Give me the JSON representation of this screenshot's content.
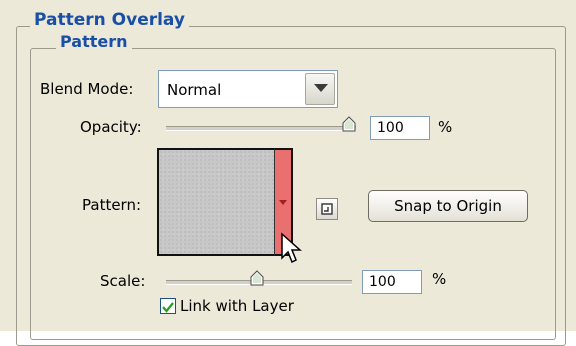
{
  "group": {
    "title": "Pattern Overlay",
    "subtitle": "Pattern"
  },
  "blend_mode": {
    "label": "Blend Mode:",
    "value": "Normal",
    "icon": "chevron-down-icon"
  },
  "opacity": {
    "label": "Opacity:",
    "value": "100",
    "unit": "%",
    "level_percent": 100
  },
  "pattern": {
    "label": "Pattern:",
    "swatch_color": "#c7c7c7",
    "picker_color": "#ea6f6f",
    "new_preset_icon": "new-preset-icon",
    "snap_button": "Snap to Origin"
  },
  "scale": {
    "label": "Scale:",
    "value": "100",
    "unit": "%"
  },
  "link": {
    "label": "Link with Layer",
    "checked": true
  },
  "colors": {
    "heading": "#1a4fa8",
    "panel": "#ece9d8"
  }
}
